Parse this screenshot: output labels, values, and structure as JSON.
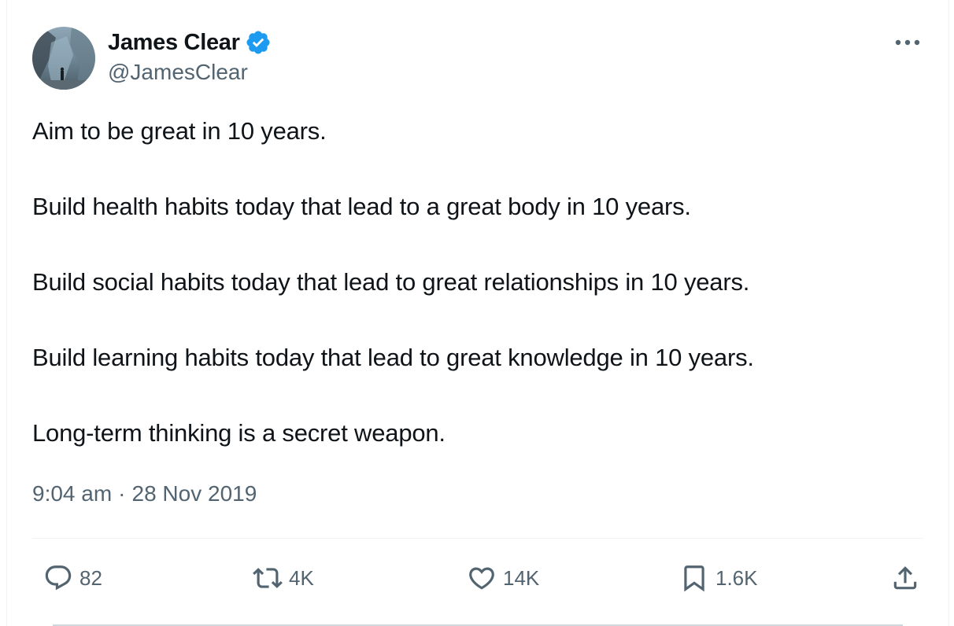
{
  "author": {
    "display_name": "James Clear",
    "handle": "@JamesClear",
    "verified": true
  },
  "tweet": {
    "paragraphs": [
      "Aim to be great in 10 years.",
      "Build health habits today that lead to a great body in 10 years.",
      "Build social habits today that lead to great relationships in 10 years.",
      "Build learning habits today that lead to great knowledge in 10 years.",
      "Long-term thinking is a secret weapon."
    ],
    "time": "9:04 am",
    "separator": "·",
    "date": "28 Nov 2019"
  },
  "actions": {
    "replies": "82",
    "reposts": "4K",
    "likes": "14K",
    "bookmarks": "1.6K"
  },
  "icons": {
    "more": "more-horizontal-icon",
    "reply": "speech-bubble-icon",
    "repost": "repost-arrows-icon",
    "like": "heart-icon",
    "bookmark": "bookmark-icon",
    "share": "share-upload-icon",
    "verified": "verified-badge-icon"
  },
  "colors": {
    "text_primary": "#0f1419",
    "text_secondary": "#536471",
    "verified_blue": "#1d9bf0",
    "divider": "#eff3f4"
  }
}
